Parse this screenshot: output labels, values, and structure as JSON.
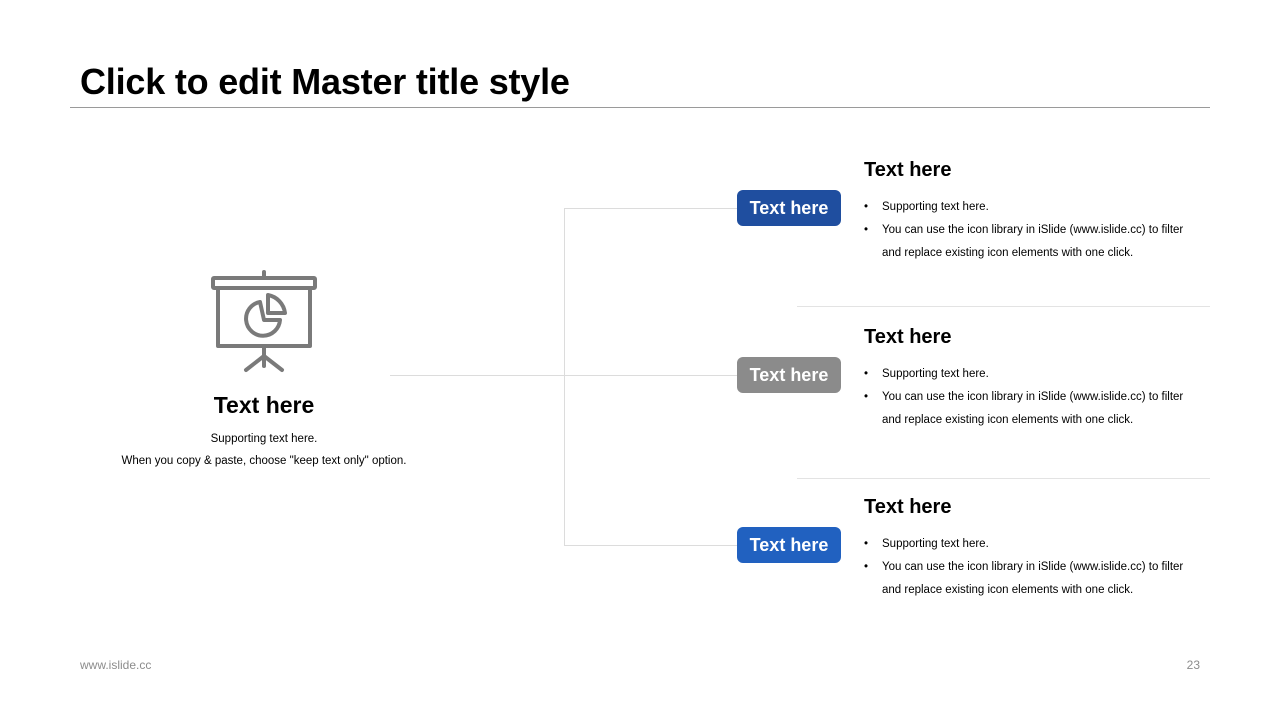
{
  "title": "Click to edit Master title style",
  "colors": {
    "accent_dark_blue": "#1f4e9f",
    "accent_gray": "#8b8b8b",
    "accent_blue": "#2161c0",
    "icon_gray": "#7a7a7a"
  },
  "left_panel": {
    "icon": "presentation-board-pie-chart-icon",
    "heading": "Text here",
    "support_line_1": "Supporting text here.",
    "support_line_2": "When you copy & paste, choose \"keep text only\" option."
  },
  "items": [
    {
      "pill_label": "Text here",
      "heading": "Text here",
      "bullets": [
        "Supporting text here.",
        "You can use the icon library in iSlide  (www.islide.cc) to filter and replace existing icon elements with one click."
      ]
    },
    {
      "pill_label": "Text here",
      "heading": "Text here",
      "bullets": [
        "Supporting text here.",
        "You can use the icon library in iSlide  (www.islide.cc) to filter and replace existing icon elements with one click."
      ]
    },
    {
      "pill_label": "Text here",
      "heading": "Text here",
      "bullets": [
        "Supporting text here.",
        "You can use the icon library in iSlide  (www.islide.cc) to filter and replace existing icon elements with one click."
      ]
    }
  ],
  "footer": {
    "website": "www.islide.cc",
    "page_number": "23"
  }
}
